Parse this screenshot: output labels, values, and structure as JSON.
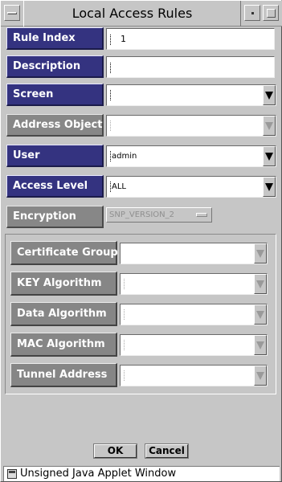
{
  "window": {
    "title": "Local Access Rules"
  },
  "fields": {
    "rule_index": {
      "label": "Rule Index",
      "value": "1"
    },
    "description": {
      "label": "Description",
      "value": ""
    },
    "screen": {
      "label": "Screen",
      "value": ""
    },
    "address_object": {
      "label": "Address Object",
      "value": ""
    },
    "user": {
      "label": "User",
      "value": "admin"
    },
    "access_level": {
      "label": "Access Level",
      "value": "ALL"
    },
    "encryption": {
      "label": "Encryption",
      "value": "SNP_VERSION_2"
    }
  },
  "encryption_group": {
    "certificate_group": {
      "label": "Certificate Group",
      "value": ""
    },
    "key_algorithm": {
      "label": "KEY Algorithm",
      "value": ""
    },
    "data_algorithm": {
      "label": "Data Algorithm",
      "value": ""
    },
    "mac_algorithm": {
      "label": "MAC Algorithm",
      "value": ""
    },
    "tunnel_address": {
      "label": "Tunnel Address",
      "value": ""
    }
  },
  "buttons": {
    "ok": "OK",
    "cancel": "Cancel"
  },
  "status": {
    "text": "Unsigned Java Applet Window"
  },
  "colors": {
    "active_label": "#343380",
    "inactive_label": "#878787",
    "window_bg": "#c6c6c6"
  },
  "icons": {
    "window_menu": "window-menu-icon",
    "minimize": "minimize-icon",
    "maximize": "maximize-icon",
    "dropdown": "chevron-down-icon",
    "applet_warning": "java-applet-icon"
  }
}
